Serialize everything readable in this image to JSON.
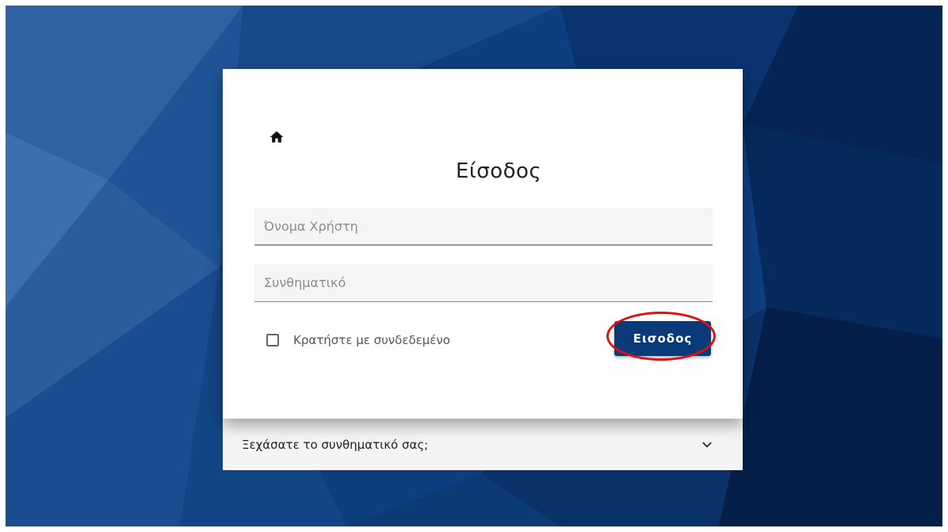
{
  "login": {
    "title": "Είσοδος",
    "username_placeholder": "Όνομα Χρήστη",
    "password_placeholder": "Συνθηματικό",
    "remember_label": "Κρατήστε με συνδεδεμένο",
    "submit_label": "Εισοδος"
  },
  "forgot": {
    "label": "Ξεχάσατε το συνθηματικό σας;"
  },
  "icons": {
    "home": "home-icon",
    "chevron": "chevron-down-icon"
  },
  "colors": {
    "brand": "#0b3a78",
    "highlight": "#e01010"
  }
}
